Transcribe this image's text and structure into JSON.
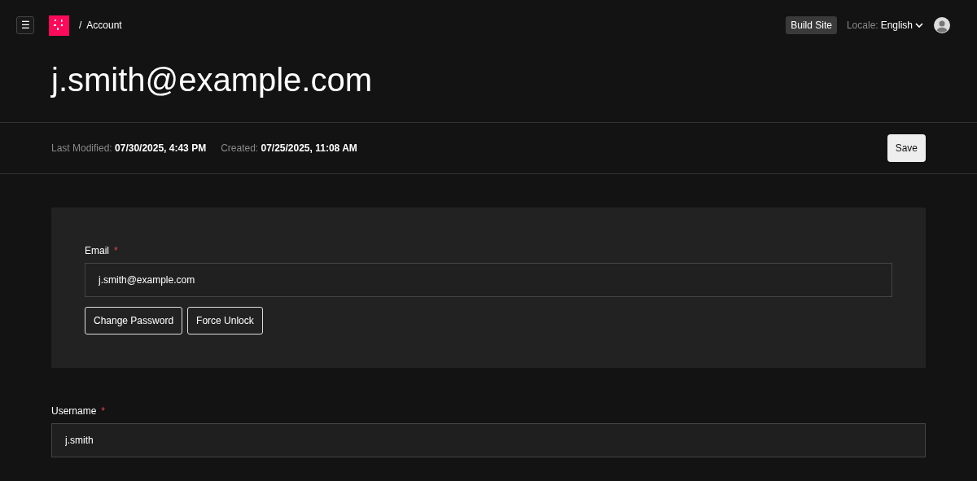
{
  "header": {
    "menu_button": "☰",
    "separator": "/",
    "breadcrumb": "Account",
    "build_button": "Build Site",
    "locale_label": "Locale:",
    "locale_value": "English"
  },
  "title": "j.smith@example.com",
  "meta": [
    {
      "label": "Last Modified:",
      "value": "07/30/2025, 4:43 PM"
    },
    {
      "label": "Created:",
      "value": "07/25/2025, 11:08 AM"
    }
  ],
  "save_button": "Save",
  "panel": {
    "field": {
      "label": "Email",
      "required_mark": "*",
      "value": "j.smith@example.com"
    },
    "buttons": [
      "Change Password",
      "Force Unlock"
    ]
  },
  "fields": [
    {
      "label": "Username",
      "required_mark": "*",
      "value": "j.smith"
    }
  ]
}
